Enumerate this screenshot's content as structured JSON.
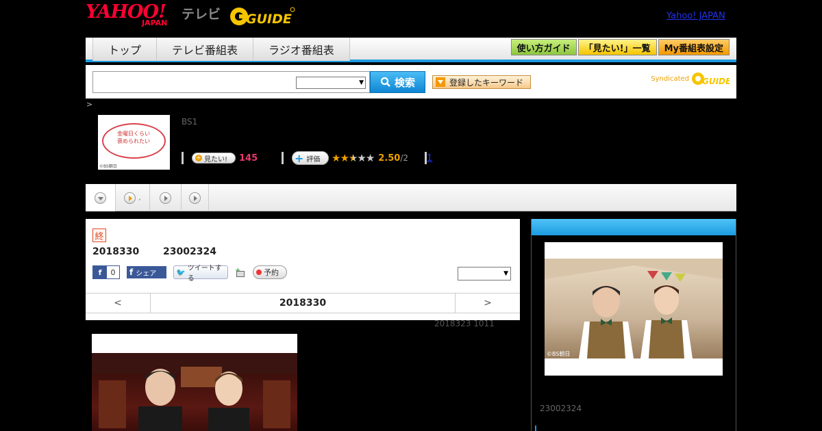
{
  "header": {
    "logo_yahoo": "YAHOO!",
    "logo_japan": "JAPAN",
    "logo_tv": "テレビ",
    "logo_gguide": "GUIDE",
    "top_link": "Yahoo! JAPAN"
  },
  "nav": {
    "tabs": [
      "トップ",
      "テレビ番組表",
      "ラジオ番組表"
    ],
    "buttons": {
      "guide": "使い方ガイド",
      "mitai_list": "「見たい!」一覧",
      "my_schedule": "My番組表設定"
    }
  },
  "search": {
    "placeholder": "",
    "button_label": "検索",
    "keyword_label": "登録したキーワード",
    "syndicated": "Syndicated",
    "syndicated_logo": "GUIDE"
  },
  "breadcrumb": ">",
  "program": {
    "thumb_text": "金曜日くらい褒められたい",
    "thumb_credit": "©BS朝日",
    "channel": "BS1",
    "mitai_label": "見たい!",
    "mitai_count": "145",
    "hyoka_label": "評価",
    "rating_value": "2.50",
    "rating_sub": "/2",
    "review_count": "1",
    "stars_filled": 2.5,
    "stars_total": 5
  },
  "tabstrip": {
    "tab2_suffix": ","
  },
  "episode": {
    "end_badge": "終",
    "date": "2018330",
    "time": "23002324",
    "fb_count": "0",
    "fb_share": "シェア",
    "tweet": "ツイートする",
    "reserve": "予約",
    "prev": "<",
    "next": ">",
    "current_date": "2018330",
    "update_note": "2018323  1011"
  },
  "sidebar": {
    "image_credit": "©BS朝日",
    "time": "23002324"
  },
  "colors": {
    "accent_blue": "#1d9be0",
    "yahoo_red": "#ff0033",
    "mitai_pink": "#e8396b",
    "rating_orange": "#f0a000"
  }
}
